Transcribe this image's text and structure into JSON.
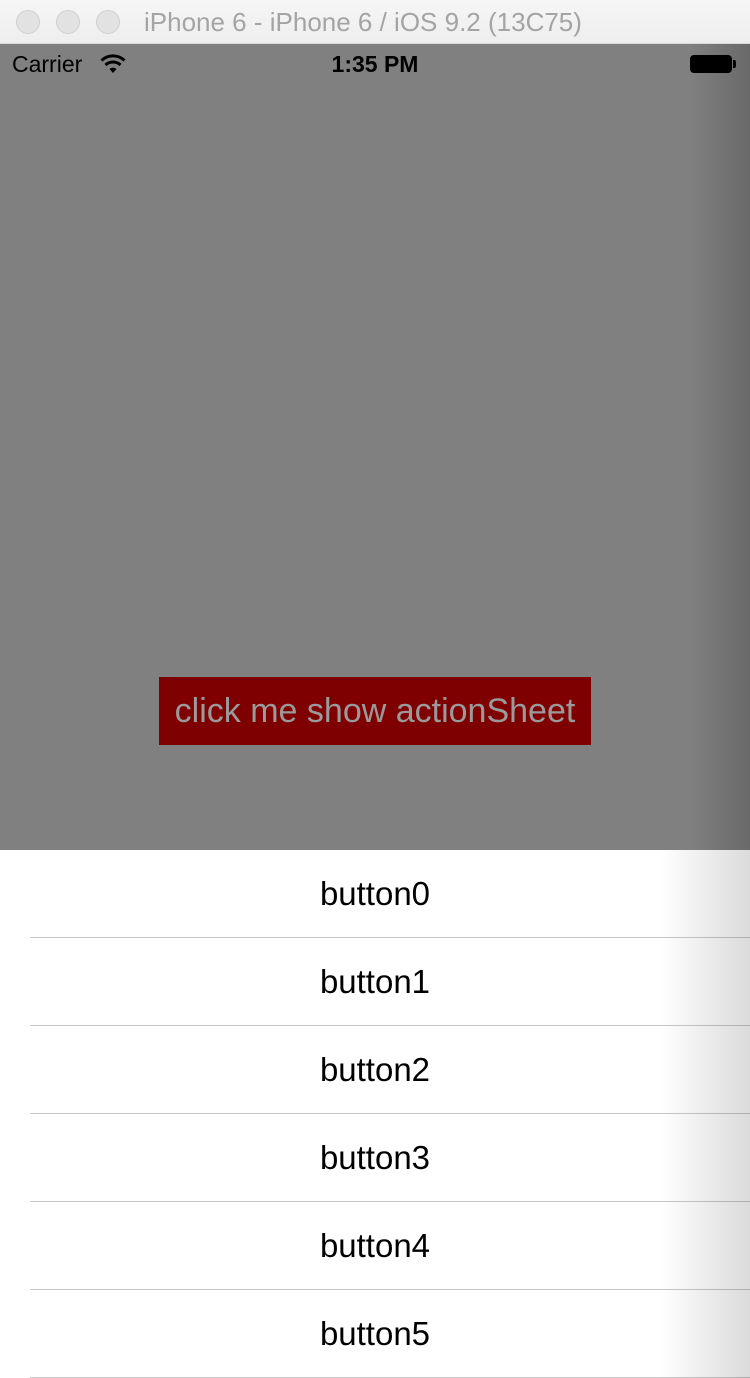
{
  "window": {
    "title": "iPhone 6 - iPhone 6 / iOS 9.2 (13C75)"
  },
  "status_bar": {
    "carrier": "Carrier",
    "time": "1:35 PM"
  },
  "main": {
    "show_button_label": "click me show actionSheet",
    "background_color": "#808080",
    "button_color": "#7f0000"
  },
  "action_sheet": {
    "items": [
      {
        "label": "button0"
      },
      {
        "label": "button1"
      },
      {
        "label": "button2"
      },
      {
        "label": "button3"
      },
      {
        "label": "button4"
      },
      {
        "label": "button5"
      }
    ]
  }
}
